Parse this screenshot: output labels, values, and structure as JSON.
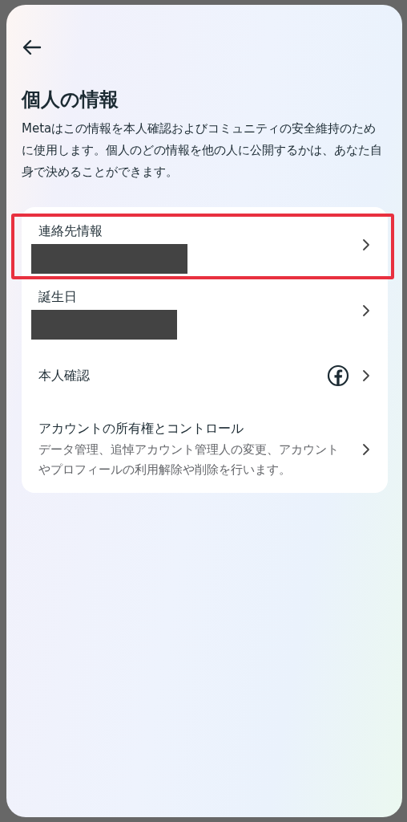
{
  "header": {
    "title": "個人の情報",
    "description": "Metaはこの情報を本人確認およびコミュニティの安全維持のために使用します。個人のどの情報を他の人に公開するかは、あなた自身で決めることができます。"
  },
  "items": [
    {
      "kind": "redacted",
      "label": "連絡先情報",
      "highlighted": true
    },
    {
      "kind": "redacted",
      "label": "誕生日",
      "highlighted": false
    },
    {
      "kind": "icon",
      "label": "本人確認",
      "highlighted": false
    },
    {
      "kind": "description",
      "label": "アカウントの所有権とコントロール",
      "description": "データ管理、追悼アカウント管理人の変更、アカウントやプロフィールの利用解除や削除を行います。",
      "highlighted": false
    }
  ]
}
